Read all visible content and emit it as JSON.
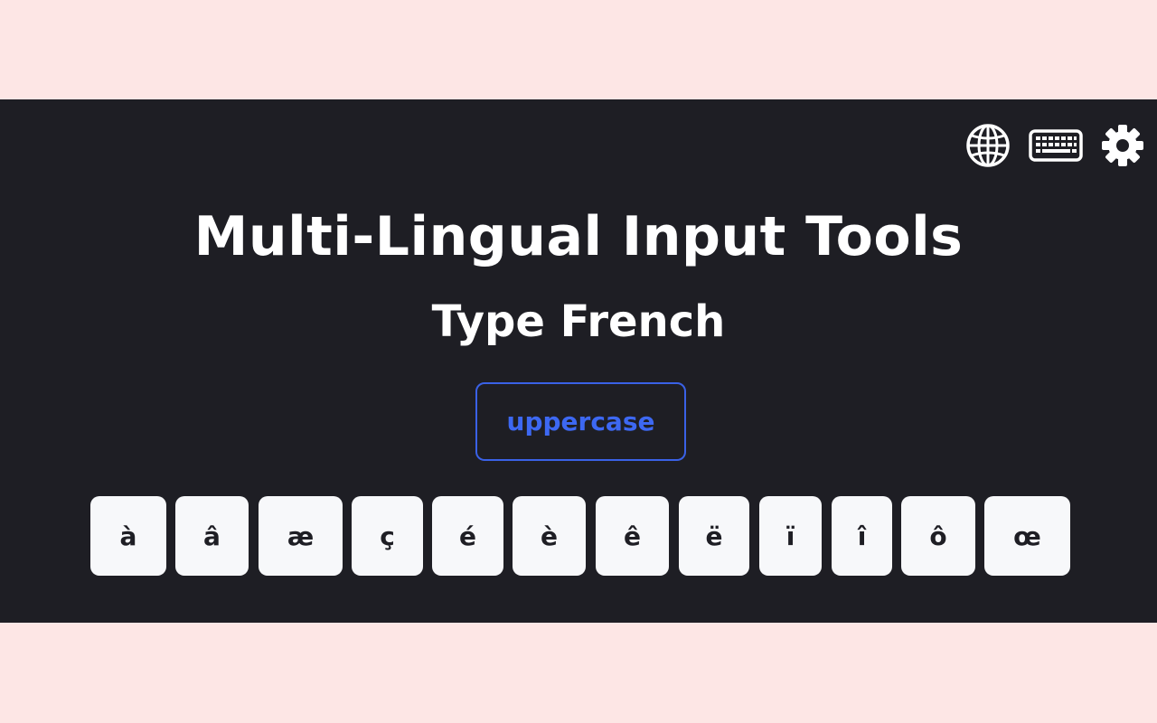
{
  "header": {
    "title": "Multi-Lingual Input Tools",
    "subtitle": "Type French"
  },
  "toolbar": {
    "icons": [
      "globe-icon",
      "keyboard-icon",
      "gear-icon"
    ]
  },
  "case_toggle": {
    "label": "uppercase"
  },
  "keys": [
    {
      "char": "à"
    },
    {
      "char": "â"
    },
    {
      "char": "æ"
    },
    {
      "char": "ç"
    },
    {
      "char": "é"
    },
    {
      "char": "è"
    },
    {
      "char": "ê"
    },
    {
      "char": "ë"
    },
    {
      "char": "ï"
    },
    {
      "char": "î"
    },
    {
      "char": "ô"
    },
    {
      "char": "œ"
    }
  ],
  "colors": {
    "page_background": "#fde6e5",
    "panel_background": "#1e1e24",
    "accent": "#3a61e6",
    "key_background": "#f7f8fa",
    "text_light": "#ffffff"
  }
}
